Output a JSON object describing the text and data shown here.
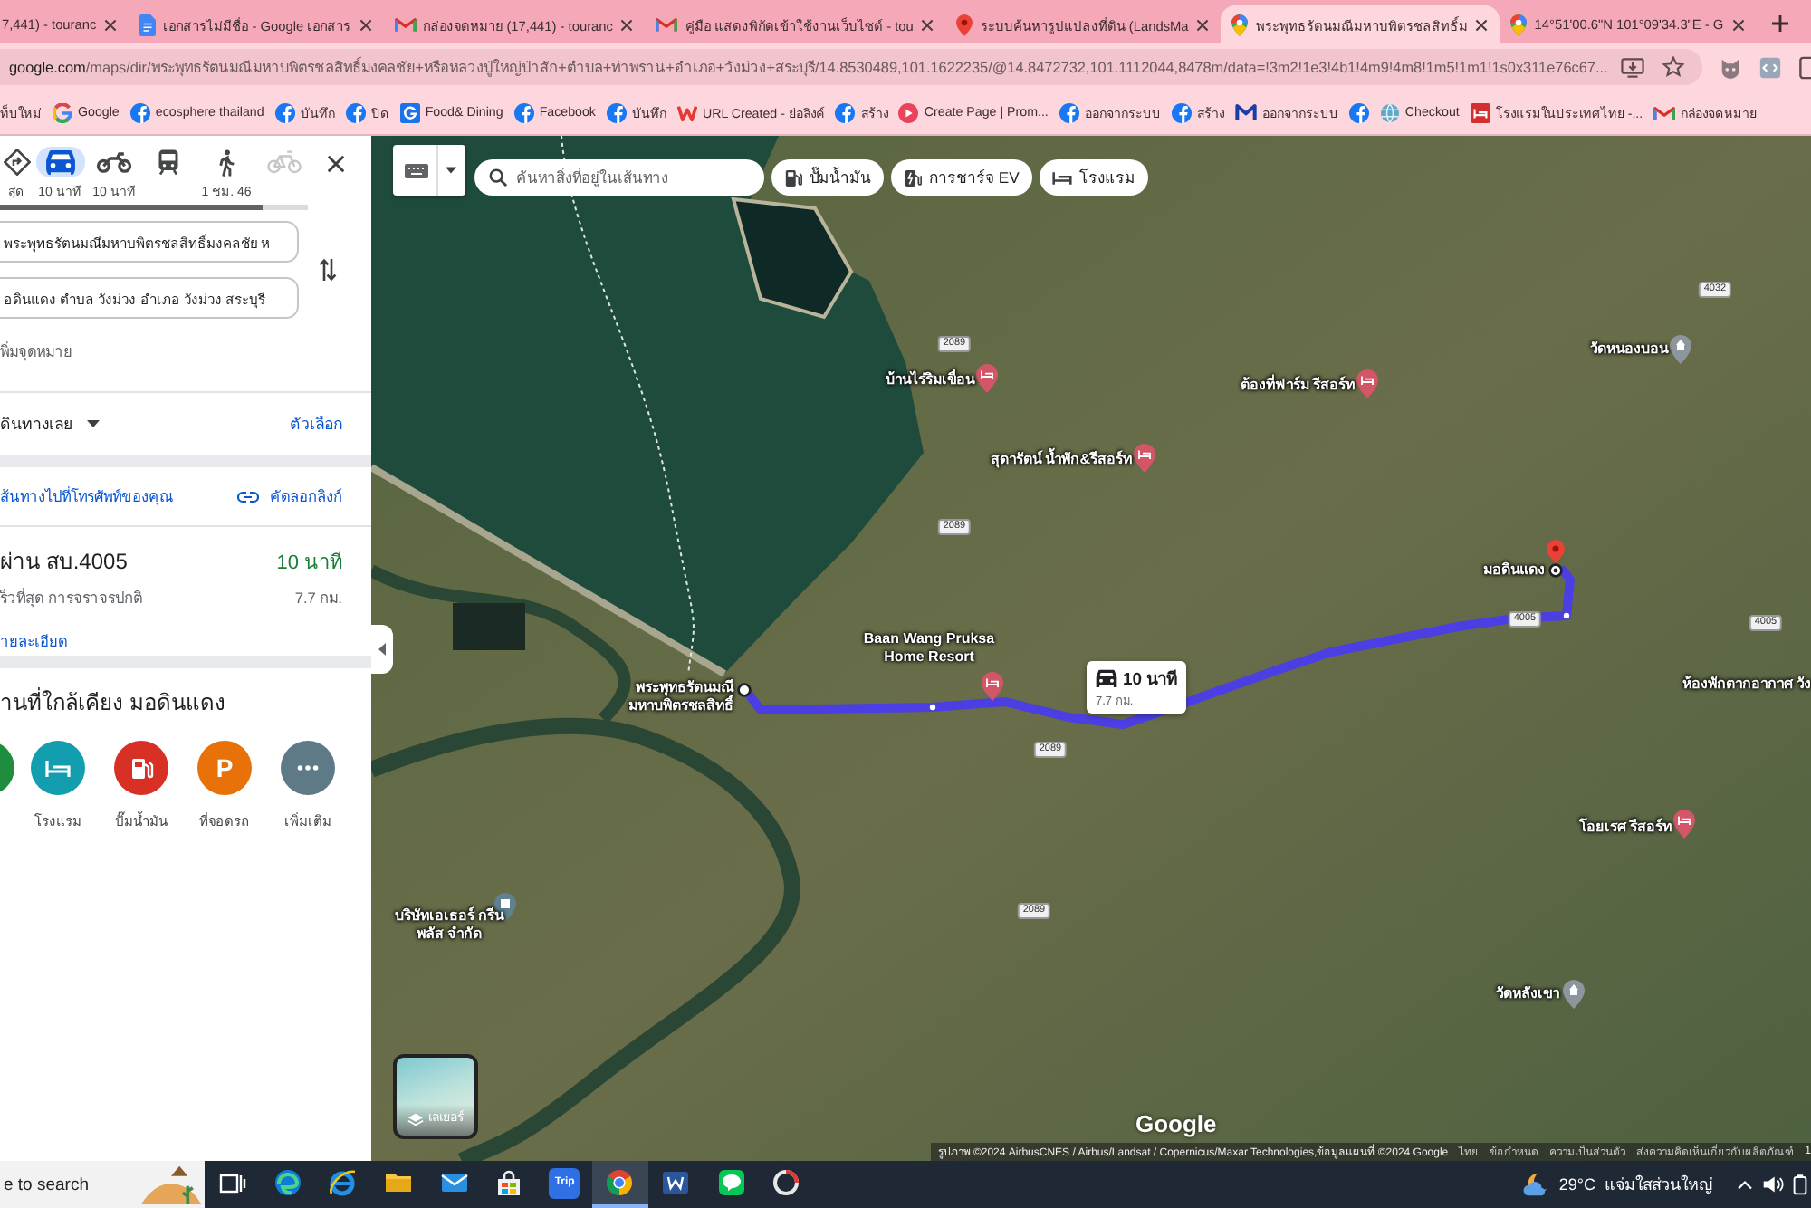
{
  "browser": {
    "tabs": [
      {
        "kind": "none",
        "title": "7,441) - touranc",
        "selected": false
      },
      {
        "kind": "docs",
        "title": "เอกสารไม่มีชื่อ - Google เอกสาร",
        "selected": false
      },
      {
        "kind": "mail",
        "title": "กล่องจดหมาย (17,441) - touranc",
        "selected": false
      },
      {
        "kind": "mail",
        "title": "คู่มือ แสดงพิกัดเข้าใช้งานเว็บไซต์ - tou",
        "selected": false
      },
      {
        "kind": "pin",
        "title": "ระบบค้นหารูปแปลงที่ดิน (LandsMa",
        "selected": false
      },
      {
        "kind": "maps",
        "title": "พระพุทธรัตนมณีมหาบพิตรชลสิทธิ์ม",
        "selected": true
      },
      {
        "kind": "maps",
        "title": "14°51'00.6\"N 101°09'34.3\"E - G",
        "selected": false
      }
    ],
    "url": {
      "domain": "google.com",
      "path": "/maps/dir/พระพุทธรัตนมณีมหาบพิตรชลสิทธิ์มงคลชัย+หรือหลวงปู่ใหญ่ป่าสัก+ตำบล+ท่าพราน+อำเภอ+วังม่วง+สระบุรี/14.8530489,101.1622235/@14.8472732,101.1112044,8478m/data=!3m2!1e3!4b1!4m9!4m8!1m5!1m1!1s0x311e76c67..."
    },
    "bookmarks": [
      {
        "kind": "none",
        "label": "ท็บใหม่"
      },
      {
        "kind": "google",
        "label": "Google"
      },
      {
        "kind": "facebook",
        "label": "ecosphere thailand"
      },
      {
        "kind": "facebook",
        "label": "บันทึก"
      },
      {
        "kind": "facebook",
        "label": "ปิด"
      },
      {
        "kind": "site",
        "label": "Food& Dining"
      },
      {
        "kind": "facebook",
        "label": "Facebook"
      },
      {
        "kind": "facebook",
        "label": "บันทึก"
      },
      {
        "kind": "w",
        "label": "URL Created - ย่อลิงค์"
      },
      {
        "kind": "facebook",
        "label": "สร้าง"
      },
      {
        "kind": "create",
        "label": "Create Page | Prom..."
      },
      {
        "kind": "facebook",
        "label": "ออกจากระบบ"
      },
      {
        "kind": "facebook",
        "label": "สร้าง"
      },
      {
        "kind": "m",
        "label": "ออกจากระบบ"
      },
      {
        "kind": "facebook"
      },
      {
        "kind": "globe",
        "label": "Checkout"
      },
      {
        "kind": "hotel",
        "label": "โรงแรมในประเทศไทย -..."
      },
      {
        "kind": "mail",
        "label": "กล่องจดหมาย"
      }
    ]
  },
  "directions": {
    "modes": [
      {
        "kind": "best",
        "label": "สุด",
        "selected": false,
        "disabled": false
      },
      {
        "kind": "car",
        "label": "10 นาที",
        "selected": true,
        "disabled": false
      },
      {
        "kind": "motorbike",
        "label": "10 นาที",
        "selected": false,
        "disabled": false
      },
      {
        "kind": "transit",
        "selected": false,
        "disabled": false
      },
      {
        "kind": "walk",
        "label": "1 ชม. 46",
        "selected": false,
        "disabled": false
      },
      {
        "kind": "bike",
        "label": "—",
        "selected": false,
        "disabled": true
      }
    ],
    "origin": "พระพุทธรัตนมณีมหาบพิตรชลสิทธิ์มงคลชัย ห",
    "destination": "อดินแดง ตำบล วังม่วง อำเภอ วังม่วง สระบุรี",
    "add_destination": "พิ่มจุดหมาย",
    "depart": "ดินทางเลย",
    "options": "ตัวเลือก",
    "send_to_phone": "ส้นทางไปที่โทรศัพท์ของคุณ",
    "copy_link": "คัดลอกลิงก์",
    "route": {
      "via": "ผ่าน สบ.4005",
      "duration": "10 นาที",
      "note": "ร็วที่สุด การจราจรปกติ",
      "distance": "7.7 กม.",
      "details": "ายละเอียด"
    },
    "nearby": {
      "title": "านที่ใกล้เคียง มอดินแดง",
      "categories": [
        {
          "kind": "restaurant"
        },
        {
          "kind": "hotel",
          "label": "โรงแรม"
        },
        {
          "kind": "gas",
          "label": "ปั๊มน้ำมัน"
        },
        {
          "kind": "parking",
          "symbol": "P",
          "label": "ที่จอดรถ"
        },
        {
          "kind": "more",
          "label": "เพิ่มเติม"
        }
      ]
    }
  },
  "map": {
    "search": {
      "placeholder": "ค้นหาสิ่งที่อยู่ในเส้นทาง"
    },
    "chips": [
      {
        "kind": "gas",
        "label": "ปั๊มน้ำมัน"
      },
      {
        "kind": "ev",
        "label": "การชาร์จ EV"
      },
      {
        "kind": "hotel",
        "label": "โรงแรม"
      }
    ],
    "places": [
      {
        "kind": "lodging",
        "name": "บ้านไร่ริมเขื่อน"
      },
      {
        "kind": "lodging",
        "name": "ต้องที่ฟาร์ม รีสอร์ท"
      },
      {
        "kind": "temple",
        "name": "วัดหนองบอน"
      },
      {
        "kind": "lodging",
        "name": "สุดารัตน์ น้ำพัก&รีสอร์ท"
      },
      {
        "kind": "lodging",
        "name": "Baan Wang Pruksa Home Resort"
      },
      {
        "kind": "start",
        "name": "พระพุทธรัตนมณี มหาบพิตรชลสิทธิ์"
      },
      {
        "kind": "destination",
        "name": "มอดินแดง"
      },
      {
        "kind": "label",
        "name": "ห้องพักตากอากาศ วัง"
      },
      {
        "kind": "lodging",
        "name": "โอยเรศ รีสอร์ท"
      },
      {
        "kind": "temple",
        "name": "วัดหลังเขา"
      },
      {
        "kind": "company",
        "name": "บริษัทเอเธอร์ กรีน พลัส จำกัด"
      }
    ],
    "road_signs": [
      "2089",
      "2089",
      "4032",
      "4005",
      "4005",
      "2089",
      "2089"
    ],
    "route_callout": {
      "duration": "10 นาที",
      "distance": "7.7 กม."
    },
    "layers_button": "เลเยอร์",
    "logo": "Google",
    "attribution": {
      "imagery": "รูปภาพ ©2024 AirbusCNES / Airbus/Landsat / Copernicus/Maxar Technologies,ข้อมูลแผนที่ ©2024 Google",
      "links": [
        "ไทย",
        "ข้อกำหนด",
        "ความเป็นส่วนตัว",
        "ส่งความคิดเห็นเกี่ยวกับผลิตภัณฑ์"
      ],
      "scale": "1"
    }
  },
  "taskbar": {
    "search": {
      "placeholder": "e to search"
    },
    "apps": [
      {
        "kind": "taskview",
        "selected": false
      },
      {
        "kind": "edge",
        "selected": false
      },
      {
        "kind": "ie",
        "selected": false
      },
      {
        "kind": "files",
        "selected": false
      },
      {
        "kind": "mail",
        "selected": false
      },
      {
        "kind": "store",
        "selected": false
      },
      {
        "kind": "trip",
        "label": "Trip",
        "selected": false
      },
      {
        "kind": "chrome",
        "selected": true
      },
      {
        "kind": "word",
        "selected": false
      },
      {
        "kind": "line",
        "selected": false
      },
      {
        "kind": "other",
        "selected": false
      }
    ],
    "weather": {
      "temperature": "29°C",
      "condition": "แจ่มใสส่วนใหญ่"
    }
  }
}
